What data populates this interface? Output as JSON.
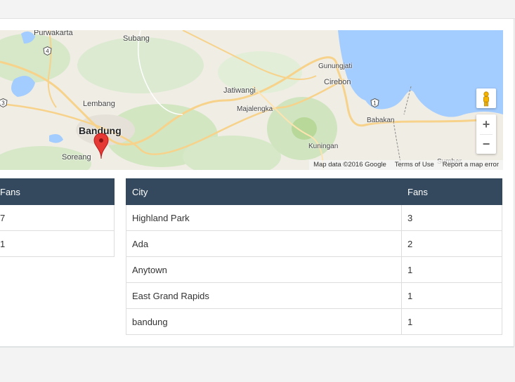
{
  "map": {
    "labels": [
      {
        "text": "Purwakarta",
        "cls": "",
        "name": "place-purwakarta"
      },
      {
        "text": "Subang",
        "cls": "",
        "name": "place-subang"
      },
      {
        "text": "Gunungjati",
        "cls": "small",
        "name": "place-gunungjati"
      },
      {
        "text": "Cirebon",
        "cls": "",
        "name": "place-cirebon"
      },
      {
        "text": "Jatiwangi",
        "cls": "",
        "name": "place-jatiwangi"
      },
      {
        "text": "Majalengka",
        "cls": "small",
        "name": "place-majalengka"
      },
      {
        "text": "Lembang",
        "cls": "",
        "name": "place-lembang"
      },
      {
        "text": "Bandung",
        "cls": "big",
        "name": "place-bandung"
      },
      {
        "text": "Babakan",
        "cls": "small",
        "name": "place-babakan"
      },
      {
        "text": "Kuningan",
        "cls": "small",
        "name": "place-kuningan"
      },
      {
        "text": "Soreang",
        "cls": "",
        "name": "place-soreang"
      },
      {
        "text": "Sumber",
        "cls": "small",
        "name": "place-sumber"
      }
    ],
    "road_markers": [
      "4",
      "3",
      "1"
    ],
    "zoom_in": "+",
    "zoom_out": "−",
    "footer": {
      "data": "Map data ©2016 Google",
      "terms": "Terms of Use",
      "report": "Report a map error"
    },
    "icons": [
      "pegman-icon",
      "map-pin-icon"
    ]
  },
  "left_table": {
    "header": "Fans",
    "rows": [
      "7",
      "1"
    ]
  },
  "right_table": {
    "headers": [
      "City",
      "Fans"
    ],
    "rows": [
      {
        "city": "Highland Park",
        "fans": "3"
      },
      {
        "city": "Ada",
        "fans": "2"
      },
      {
        "city": "Anytown",
        "fans": "1"
      },
      {
        "city": "East Grand Rapids",
        "fans": "1"
      },
      {
        "city": "bandung",
        "fans": "1"
      }
    ]
  },
  "colors": {
    "table_header": "#34495e",
    "water": "#a3ccff",
    "pin": "#e53935"
  }
}
